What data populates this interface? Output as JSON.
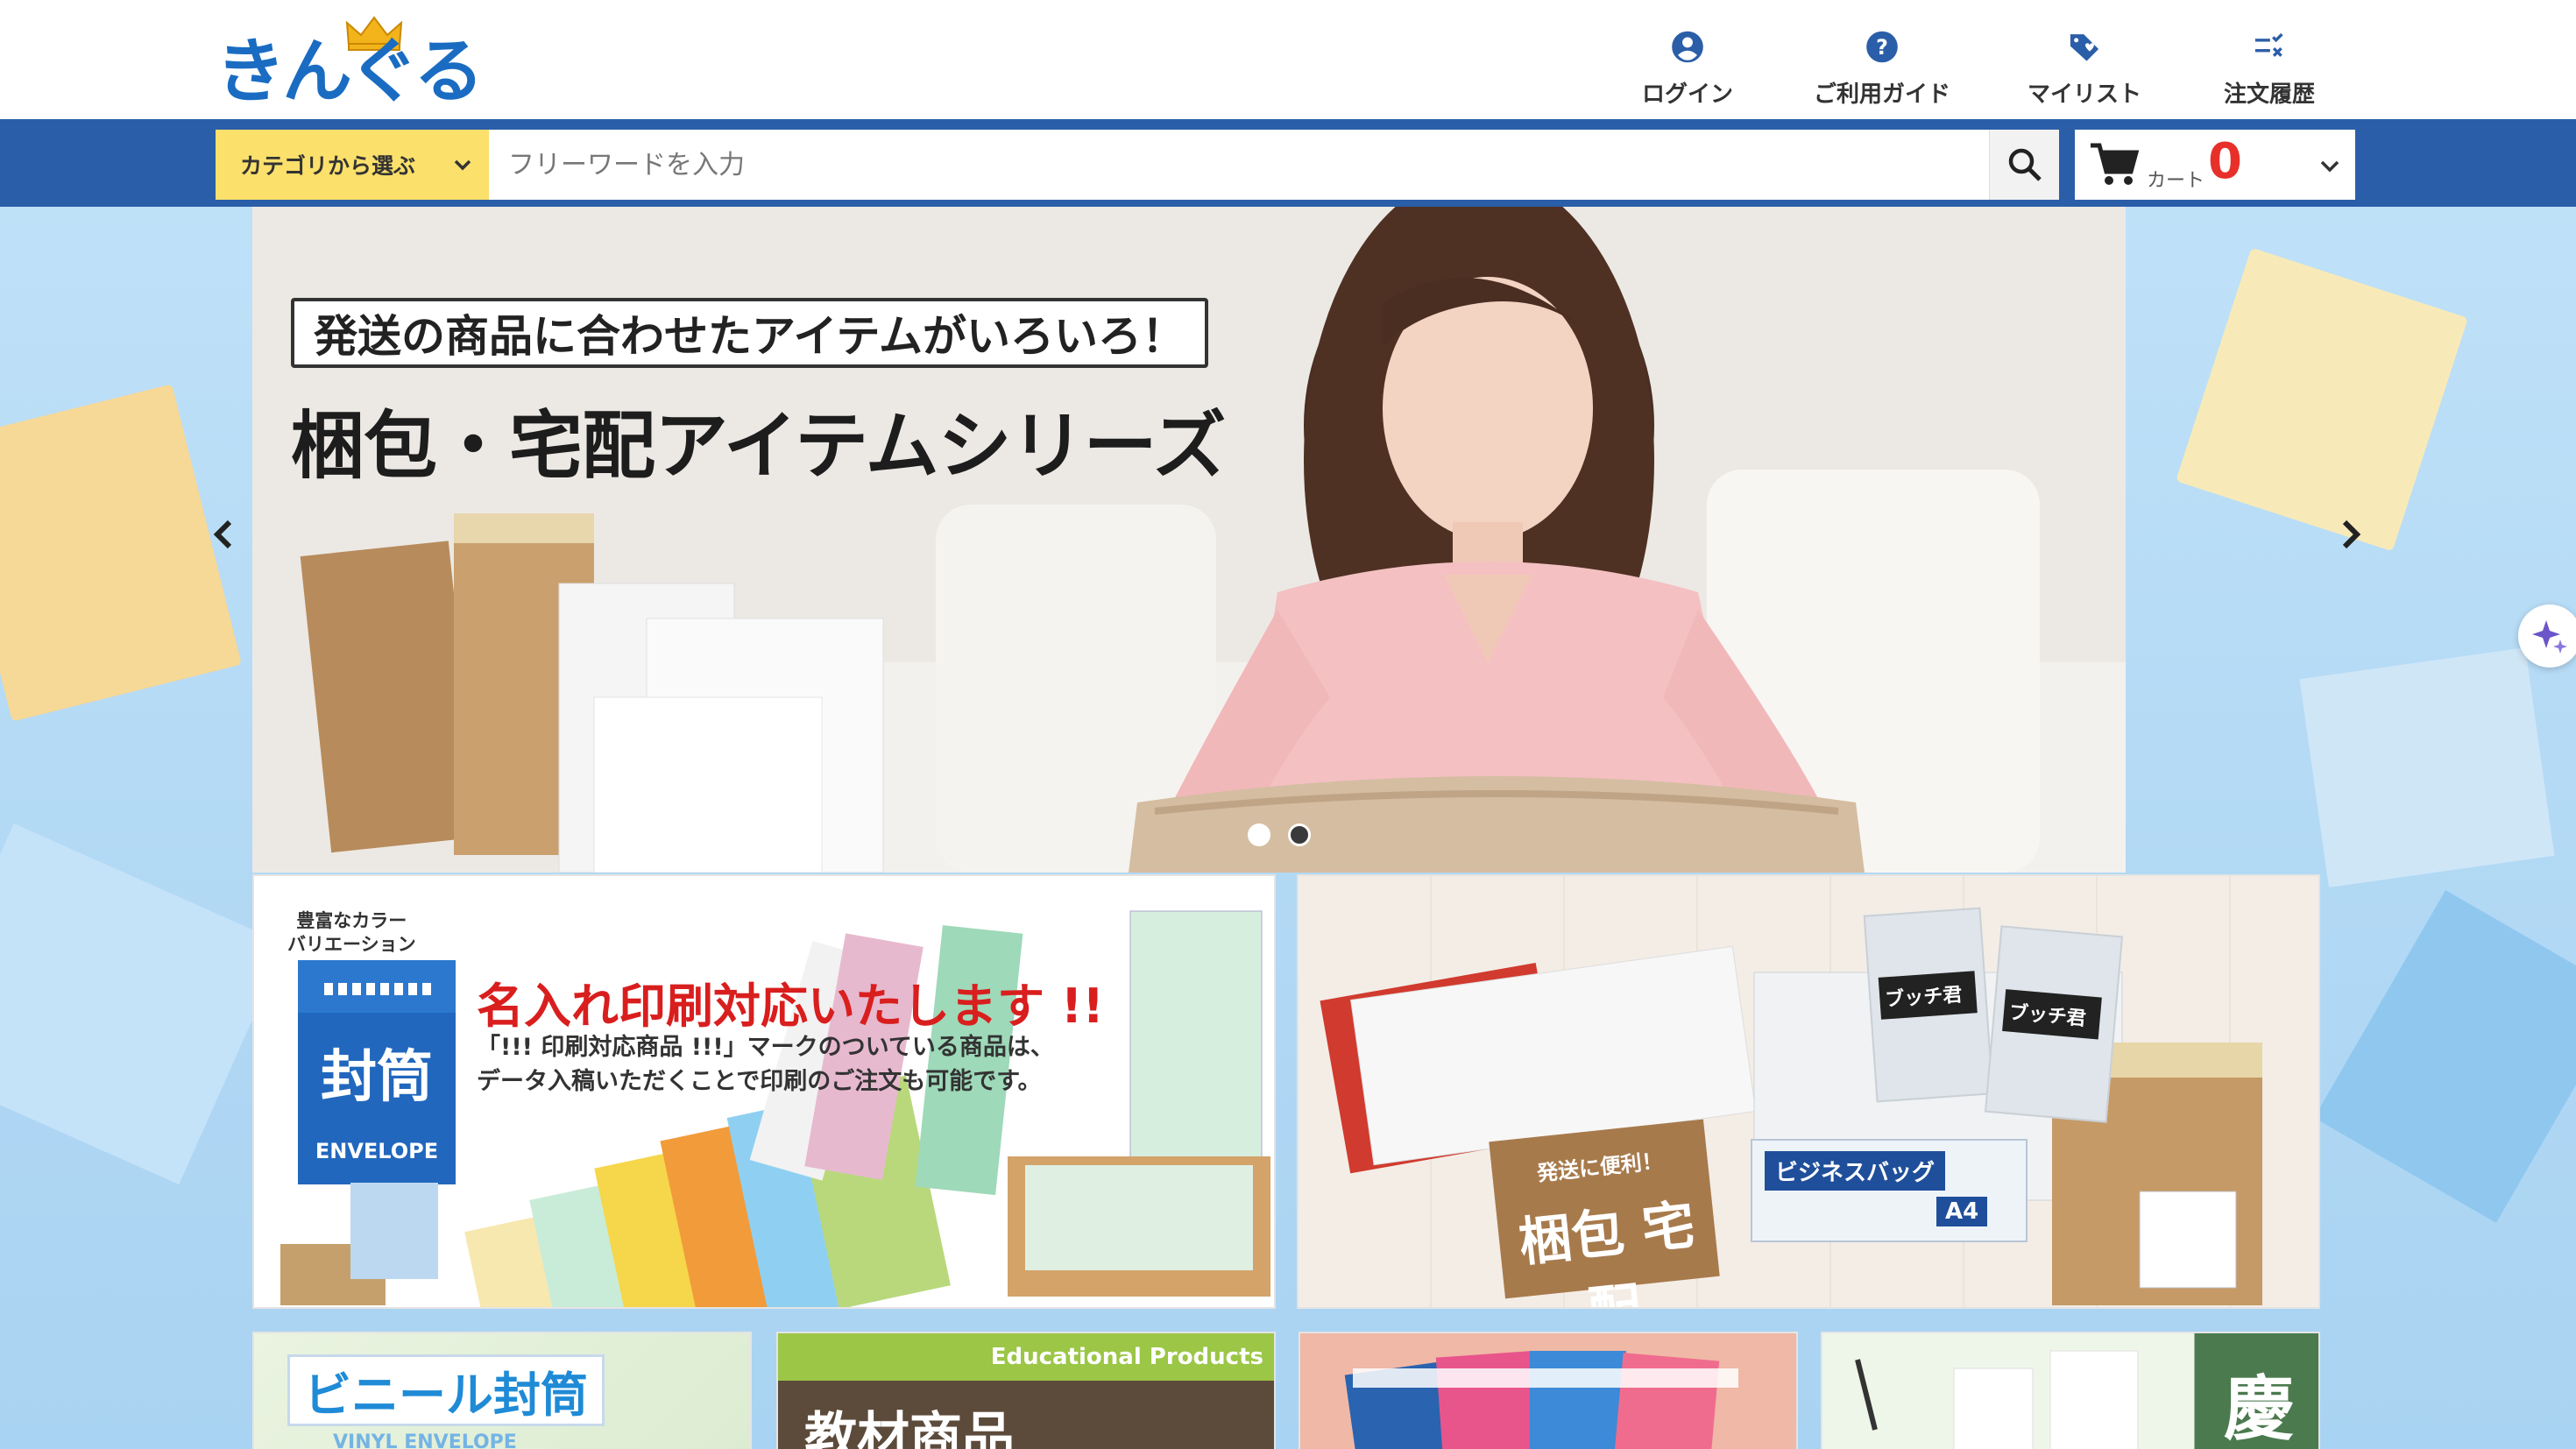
{
  "header": {
    "logo_text": "きんぐる",
    "nav": [
      {
        "label": "ログイン",
        "icon": "account-circle-icon"
      },
      {
        "label": "ご利用ガイド",
        "icon": "help-circle-icon"
      },
      {
        "label": "マイリスト",
        "icon": "tag-heart-icon"
      },
      {
        "label": "注文履歴",
        "icon": "order-history-icon"
      }
    ]
  },
  "search": {
    "category_label": "カテゴリから選ぶ",
    "placeholder": "フリーワードを入力",
    "value": ""
  },
  "cart": {
    "label": "カート",
    "count": "0"
  },
  "hero": {
    "tagline": "発送の商品に合わせたアイテムがいろいろ！",
    "title": "梱包・宅配アイテムシリーズ",
    "slide_count": 2,
    "active_slide": 1
  },
  "banners": {
    "print": {
      "tag": "豊富なカラー\nバリエーション",
      "envelope_big": "封筒",
      "envelope_small": "ENVELOPE",
      "title": "名入れ印刷対応いたします !!",
      "body_line1": "「!!! 印刷対応商品 !!!」マークのついている商品は、",
      "body_line2": "データ入稿いただくことで印刷のご注文も可能です。"
    },
    "packing": {
      "stamp_small": "発送に便利！",
      "stamp_big": "梱包 宅配",
      "pack1": "ブッチ君",
      "pack2": "ブッチ君",
      "pack_size": "A4",
      "biz_bag": "ビジネスバッグ"
    }
  },
  "cards": {
    "vinyl_title": "ビニール封筒",
    "vinyl_sub": "VINYL ENVELOPE",
    "edu_title": "Educational Products",
    "edu_kanji": "教材商品",
    "keiji_kanji": "慶"
  },
  "colors": {
    "brand_blue": "#2b5ea8",
    "logo_blue": "#1a6cc2",
    "category_yellow": "#fbe06b",
    "cart_red": "#e8302a"
  }
}
